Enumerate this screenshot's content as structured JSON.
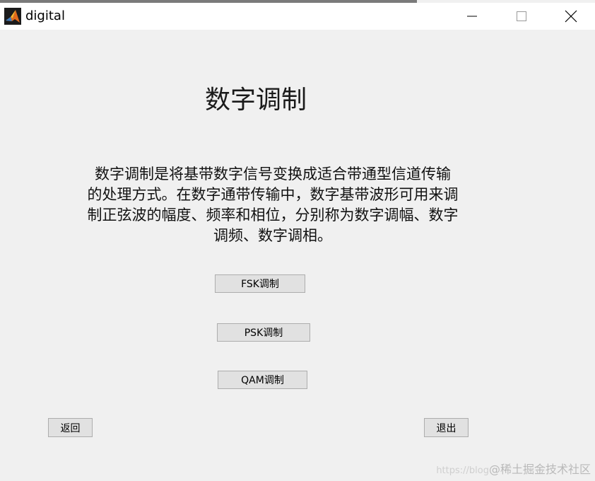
{
  "window": {
    "title": "digital",
    "controls": {
      "minimize": "minimize",
      "maximize": "maximize",
      "close": "close"
    }
  },
  "main": {
    "heading": "数字调制",
    "description_lines": [
      "数字调制是将基带数字信号变换成适合带通型信道传输",
      "的处理方式。在数字通带传输中，数字基带波形可用来调",
      "制正弦波的幅度、频率和相位，分别称为数字调幅、数字",
      "调频、数字调相。"
    ],
    "buttons": {
      "fsk": "FSK调制",
      "psk": "PSK调制",
      "qam": "QAM调制",
      "back": "返回",
      "exit": "退出"
    }
  },
  "watermark": {
    "url": "https://blog",
    "text": "@稀土掘金技术社区"
  },
  "colors": {
    "background": "#f0f0f0",
    "titlebar": "#ffffff",
    "button_face": "#e1e1e1",
    "button_border": "#adadad"
  }
}
